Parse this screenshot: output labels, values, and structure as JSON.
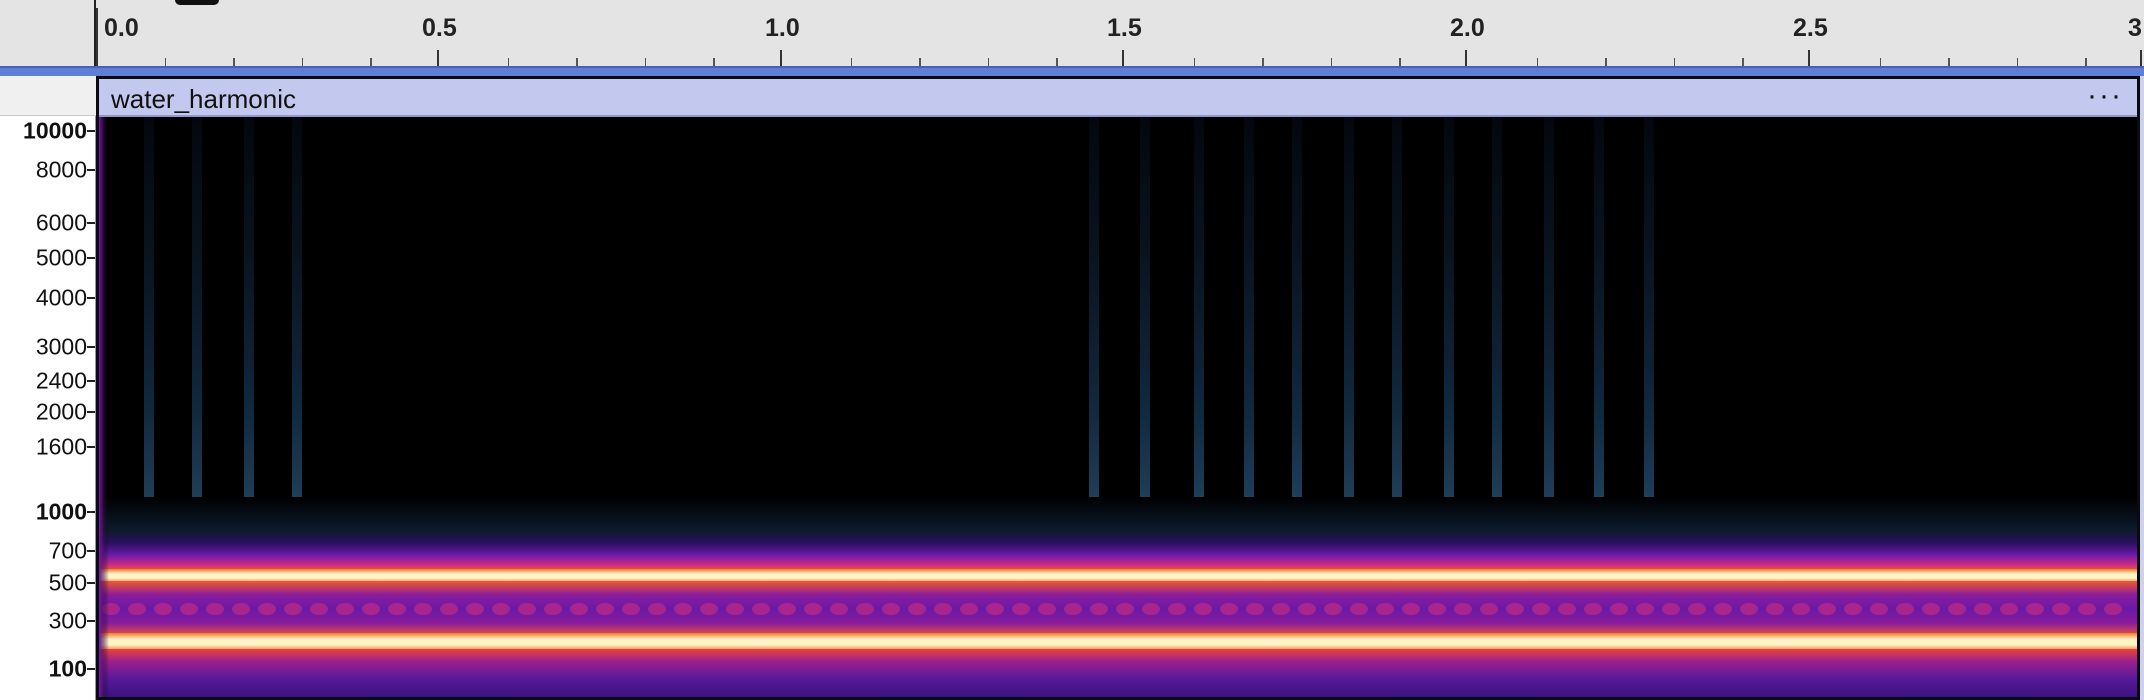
{
  "timeline": {
    "labels": [
      "0.0",
      "0.5",
      "1.0",
      "1.5",
      "2.0",
      "2.5",
      "3"
    ]
  },
  "clip": {
    "name": "water_harmonic",
    "menu_label": "···"
  },
  "frequency_axis": {
    "labels": [
      "10000",
      "8000",
      "6000",
      "5000",
      "4000",
      "3000",
      "2400",
      "2000",
      "1600",
      "1000",
      "700",
      "500",
      "300",
      "100"
    ]
  },
  "colors": {
    "timeline_bg": "#e4e4e4",
    "track_separator": "#5f7fd6",
    "clip_header": "#c2c8ee",
    "spectrogram_bg": "#000000",
    "band_hot": "#fff3c8",
    "band_mid": "#e8443a",
    "band_low": "#5a1a9a"
  }
}
